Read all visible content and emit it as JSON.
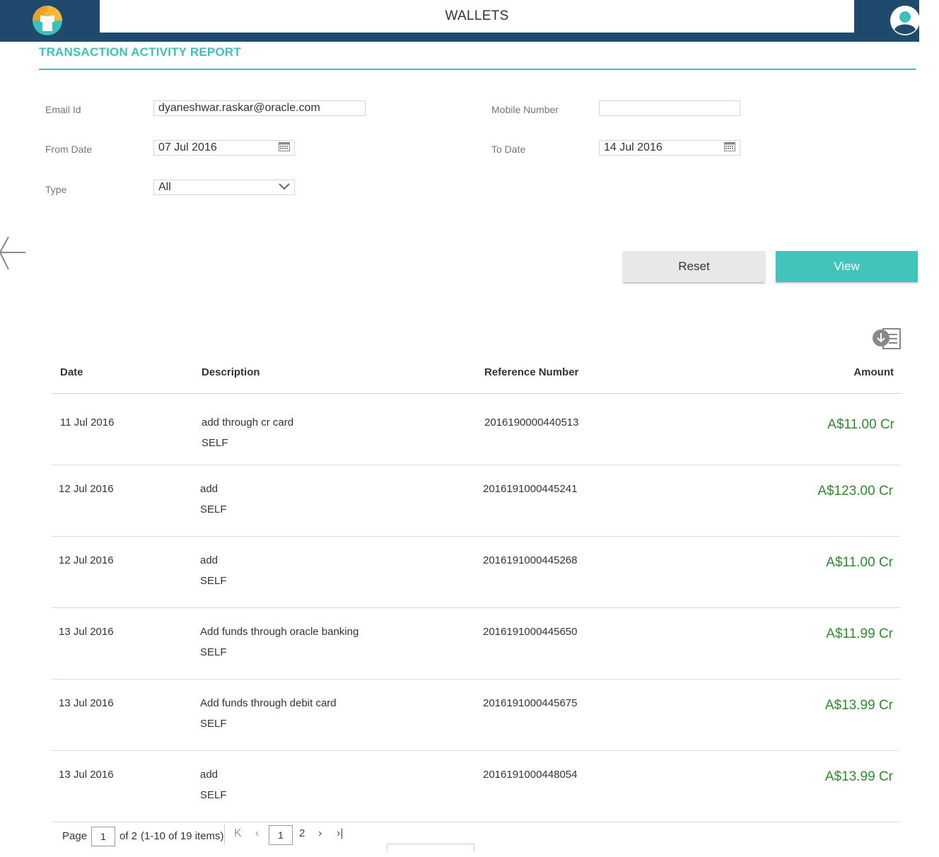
{
  "header": {
    "title": "WALLETS",
    "logo_icon": "wallet-logo-icon",
    "avatar_icon": "user-avatar-icon"
  },
  "report": {
    "title": "TRANSACTION ACTIVITY REPORT"
  },
  "form": {
    "email_label": "Email Id",
    "email_value": "dyaneshwar.raskar@oracle.com",
    "mobile_label": "Mobile Number",
    "mobile_value": "",
    "from_label": "From Date",
    "from_value": "07 Jul 2016",
    "to_label": "To Date",
    "to_value": "14 Jul 2016",
    "type_label": "Type",
    "type_value": "All"
  },
  "actions": {
    "reset_label": "Reset",
    "view_label": "View"
  },
  "table": {
    "columns": {
      "date": "Date",
      "description": "Description",
      "reference": "Reference Number",
      "amount": "Amount"
    },
    "rows": [
      {
        "date": "11 Jul 2016",
        "description": "add through cr card",
        "sub": "SELF",
        "reference": "2016190000440513",
        "amount": "A$11.00 Cr"
      },
      {
        "date": "12 Jul 2016",
        "description": "add",
        "sub": "SELF",
        "reference": "2016191000445241",
        "amount": "A$123.00 Cr"
      },
      {
        "date": "12 Jul 2016",
        "description": "add",
        "sub": "SELF",
        "reference": "2016191000445268",
        "amount": "A$11.00 Cr"
      },
      {
        "date": "13 Jul 2016",
        "description": "Add funds through oracle banking",
        "sub": "SELF",
        "reference": "2016191000445650",
        "amount": "A$11.99 Cr"
      },
      {
        "date": "13 Jul 2016",
        "description": "Add funds through debit card",
        "sub": "SELF",
        "reference": "2016191000445675",
        "amount": "A$13.99 Cr"
      },
      {
        "date": "13 Jul 2016",
        "description": "add",
        "sub": "SELF",
        "reference": "2016191000448054",
        "amount": "A$13.99 Cr"
      }
    ]
  },
  "pager": {
    "page_label": "Page",
    "page_input": "1",
    "of_text": "of 2",
    "items_text": "(1-10 of 19 items)",
    "current_page": "1",
    "next_page": "2"
  },
  "colors": {
    "topbar": "#1f4a6e",
    "accent": "#3fbfb9",
    "view_button": "#42c4bd",
    "amount": "#2e8b2e"
  }
}
